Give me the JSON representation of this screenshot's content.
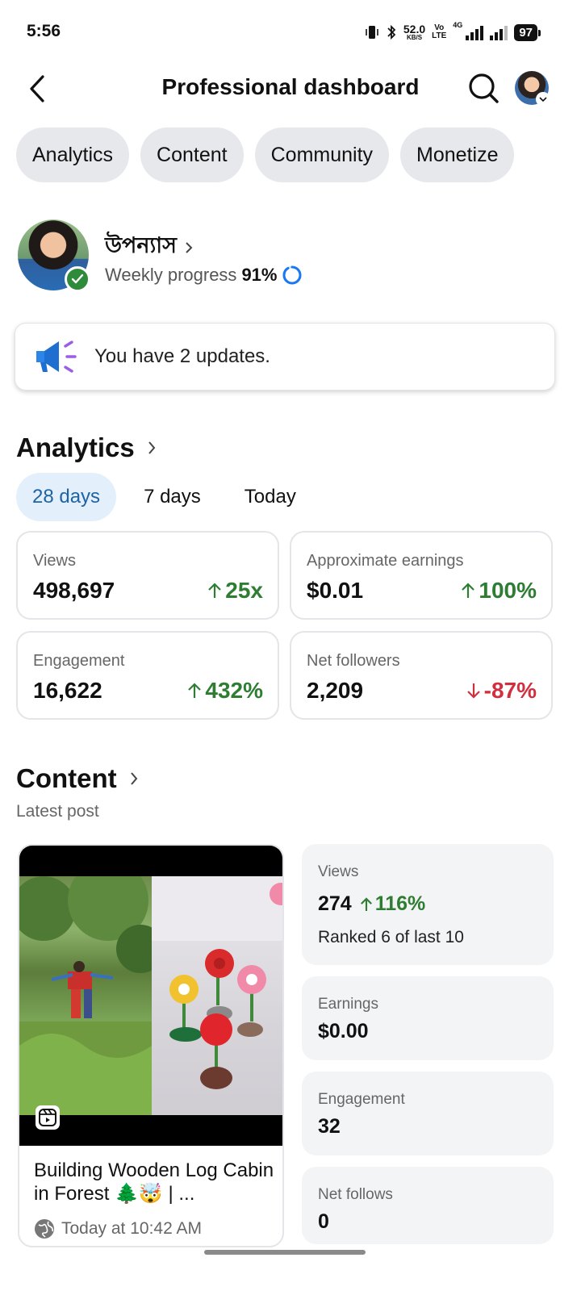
{
  "status_bar": {
    "time": "5:56",
    "net_speed": "52.0",
    "net_unit": "KB/S",
    "volte_1": "Vo",
    "volte_2": "LTE",
    "network": "4G",
    "battery": "97",
    "icons": [
      "vibrate-icon",
      "bluetooth-icon",
      "signal-icon",
      "signal-icon"
    ]
  },
  "header": {
    "title": "Professional dashboard",
    "back_icon": "back-arrow-icon",
    "search_icon": "search-icon"
  },
  "tabs": [
    {
      "label": "Analytics"
    },
    {
      "label": "Content"
    },
    {
      "label": "Community"
    },
    {
      "label": "Monetize"
    }
  ],
  "profile": {
    "name": "উপন্যাস",
    "progress_label": "Weekly progress",
    "progress_value": "91%",
    "progress_fraction": 0.91
  },
  "updates": {
    "text": "You have 2 updates."
  },
  "analytics": {
    "title": "Analytics",
    "ranges": [
      {
        "label": "28 days",
        "active": true
      },
      {
        "label": "7 days",
        "active": false
      },
      {
        "label": "Today",
        "active": false
      }
    ],
    "metrics": [
      {
        "label": "Views",
        "value": "498,697",
        "delta": "25x",
        "direction": "up"
      },
      {
        "label": "Approximate earnings",
        "value": "$0.01",
        "delta": "100%",
        "direction": "up"
      },
      {
        "label": "Engagement",
        "value": "16,622",
        "delta": "432%",
        "direction": "up"
      },
      {
        "label": "Net followers",
        "value": "2,209",
        "delta": "-87%",
        "direction": "down"
      }
    ]
  },
  "content": {
    "title": "Content",
    "subtitle": "Latest post",
    "post": {
      "title": "Building Wooden Log Cabin in Forest 🌲🤯 | ...",
      "time": "Today at 10:42 AM"
    },
    "stats": {
      "views_label": "Views",
      "views_value": "274",
      "views_delta": "116%",
      "views_rank": "Ranked 6 of last 10",
      "earnings_label": "Earnings",
      "earnings_value": "$0.00",
      "engagement_label": "Engagement",
      "engagement_value": "32",
      "follows_label": "Net follows",
      "follows_value": "0"
    }
  },
  "colors": {
    "up": "#2e7d32",
    "down": "#d12f3e",
    "active_tab_bg": "#e3f0fb",
    "active_tab_text": "#1e63a6",
    "pill_bg": "#e6e8eb",
    "verified": "#2e8b3a"
  }
}
